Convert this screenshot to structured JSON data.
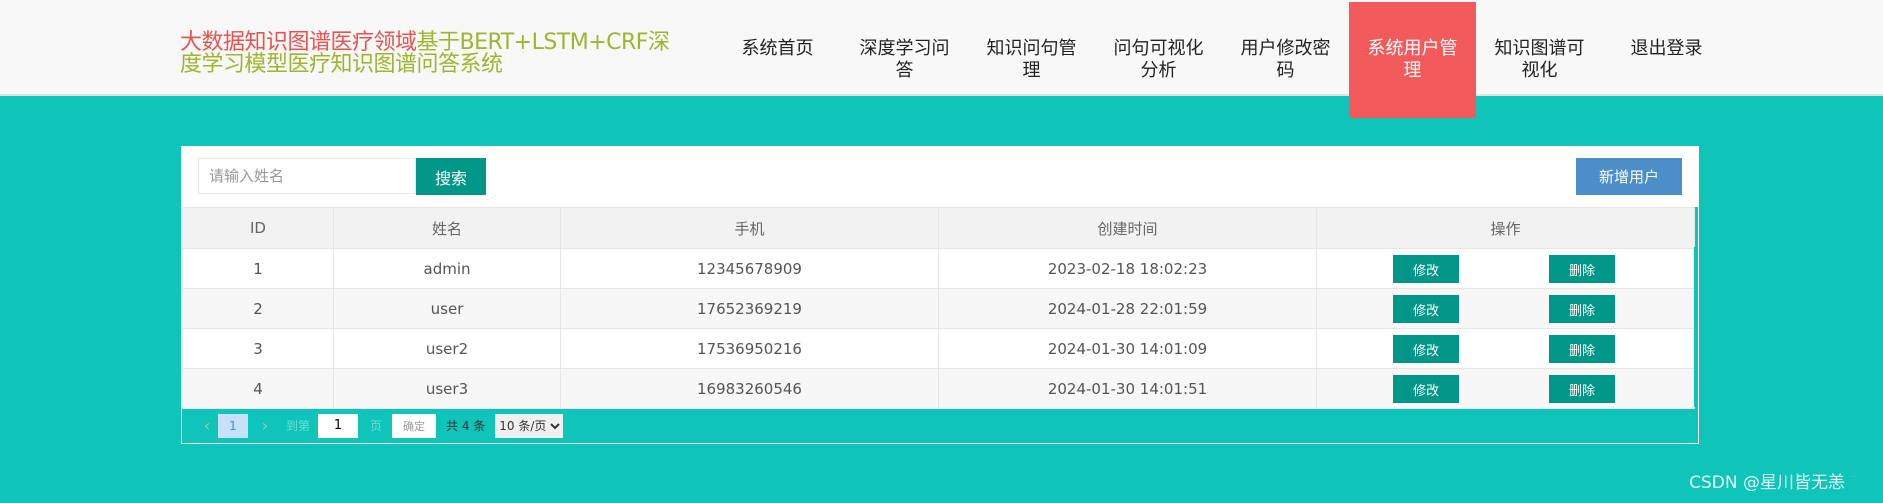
{
  "header": {
    "brand_part1": "大数据知识图谱医疗领域",
    "brand_part2": "基于BERT+LSTM+CRF深度学习模型医疗知识图谱问答系统",
    "nav": [
      {
        "label": "系统首页"
      },
      {
        "label": "深度学习问答"
      },
      {
        "label": "知识问句管理"
      },
      {
        "label": "问句可视化分析"
      },
      {
        "label": "用户修改密码"
      },
      {
        "label": "系统用户管理",
        "active": true
      },
      {
        "label": "知识图谱可视化"
      },
      {
        "label": "退出登录"
      }
    ]
  },
  "toolbar": {
    "search_placeholder": "请输入姓名",
    "search_value": "",
    "search_label": "搜索",
    "add_label": "新增用户"
  },
  "table": {
    "columns": [
      "ID",
      "姓名",
      "手机",
      "创建时间",
      "操作"
    ],
    "rows": [
      {
        "id": "1",
        "name": "admin",
        "phone": "12345678909",
        "created": "2023-02-18 18:02:23",
        "edit": "修改",
        "delete": "删除"
      },
      {
        "id": "2",
        "name": "user",
        "phone": "17652369219",
        "created": "2024-01-28 22:01:59",
        "edit": "修改",
        "delete": "删除"
      },
      {
        "id": "3",
        "name": "user2",
        "phone": "17536950216",
        "created": "2024-01-30 14:01:09",
        "edit": "修改",
        "delete": "删除"
      },
      {
        "id": "4",
        "name": "user3",
        "phone": "16983260546",
        "created": "2024-01-30 14:01:51",
        "edit": "修改",
        "delete": "删除"
      }
    ]
  },
  "pager": {
    "prev_icon": "chevron-left-icon",
    "next_icon": "chevron-right-icon",
    "current_page": "1",
    "goto_label": "到第",
    "goto_value": "1",
    "page_label": "页",
    "confirm_label": "确定",
    "total_label": "共 4 条",
    "page_size": "10 条/页"
  },
  "watermark": "CSDN @星川皆无恙",
  "colors": {
    "background": "#0fc4b8",
    "active_nav": "#f25a5b",
    "primary_button": "#009688",
    "add_button": "#4c8fc8",
    "brand_red": "#e8534f",
    "brand_green": "#9fb52e"
  }
}
